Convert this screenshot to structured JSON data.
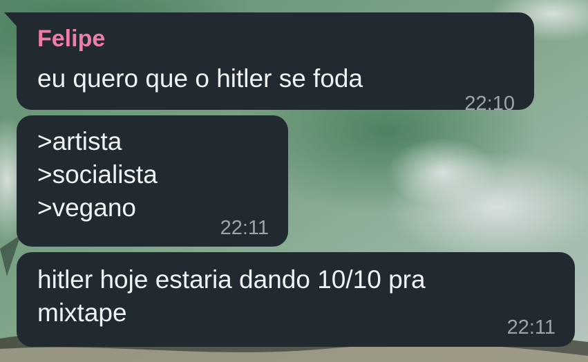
{
  "chat": {
    "messages": [
      {
        "sender": "Felipe",
        "text": "eu quero que o hitler se foda",
        "time": "22:10"
      },
      {
        "sender": "",
        "text": ">artista\n>socialista\n>vegano",
        "time": "22:11"
      },
      {
        "sender": "",
        "text": "hitler hoje estaria dando 10/10 pra\nmixtape",
        "time": "22:11"
      }
    ]
  },
  "colors": {
    "bubble_bg": "#212a30",
    "sender_name": "#f07da7",
    "timestamp": "#9aa5ac",
    "message_text": "#f0f3f4"
  }
}
